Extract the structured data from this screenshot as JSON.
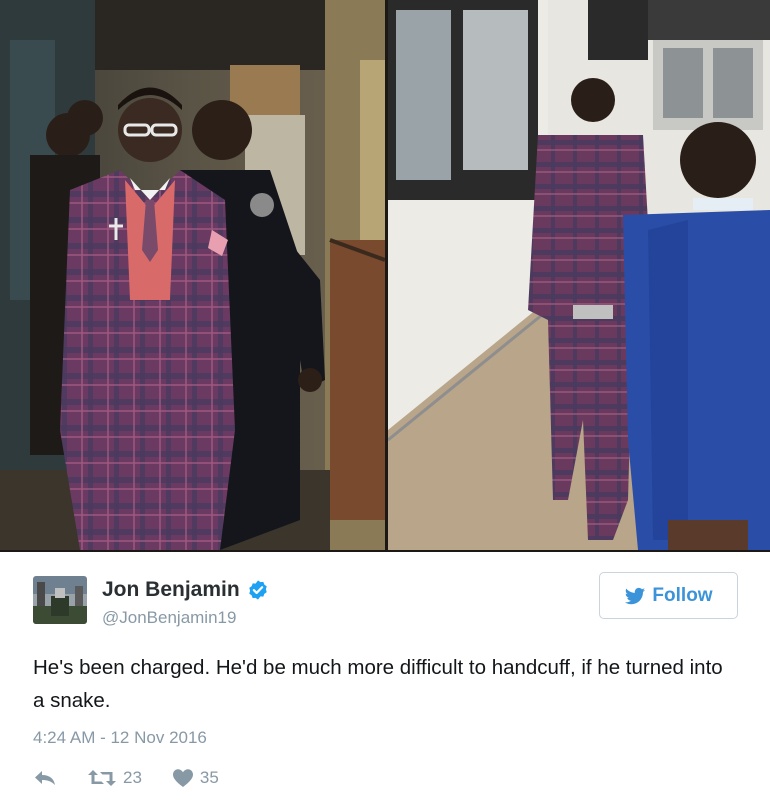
{
  "photos": {
    "left_alt": "photo-left",
    "right_alt": "photo-right"
  },
  "tweet": {
    "author_name": "Jon Benjamin",
    "author_handle": "@JonBenjamin19",
    "follow_label": "Follow",
    "text": "He's been charged. He'd be much more difficult to handcuff, if he turned into a snake.",
    "timestamp": "4:24 AM - 12 Nov 2016",
    "retweet_count": "23",
    "like_count": "35",
    "verified": true
  },
  "icons": {
    "reply": "reply-icon",
    "retweet": "retweet-icon",
    "like": "heart-icon",
    "verified": "verified-badge-icon",
    "twitter_bird": "twitter-bird-icon"
  },
  "colors": {
    "accent": "#3b94d9",
    "verified": "#1da1f2",
    "muted": "#8899a6",
    "text": "#14171a"
  }
}
